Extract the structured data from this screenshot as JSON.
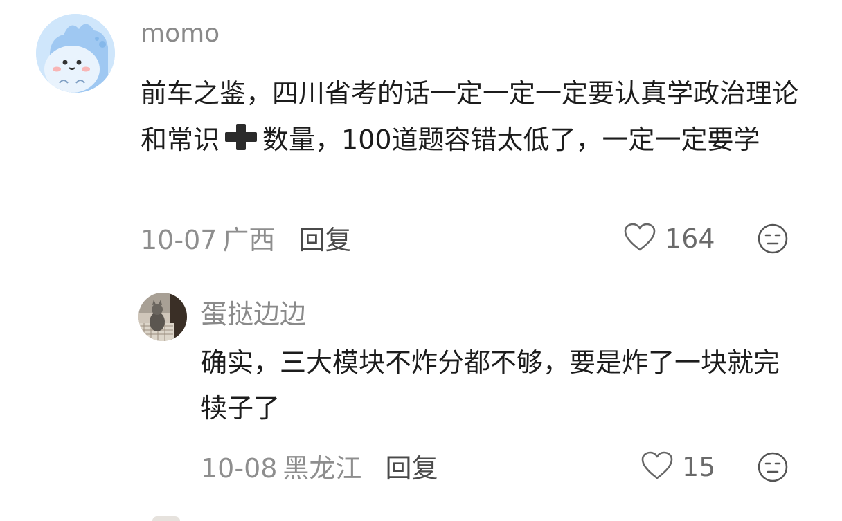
{
  "comments": [
    {
      "username": "momo",
      "content_part1": "前车之鉴，四川省考的话一定一定一定要认真学政治理论和常识",
      "content_part2": "数量，100道题容错太低了，一定一定要学",
      "date": "10-07",
      "location": "广西",
      "reply_label": "回复",
      "likes": "164",
      "avatar_icon": "cartoon-dinosaur-avatar",
      "avatar_color": "#cfe6fb"
    },
    {
      "username": "蛋挞边边",
      "content": "确实，三大模块不炸分都不够，要是炸了一块就完犊子了",
      "date": "10-08",
      "location": "黑龙江",
      "reply_label": "回复",
      "likes": "15",
      "avatar_icon": "cat-photo-avatar"
    }
  ]
}
